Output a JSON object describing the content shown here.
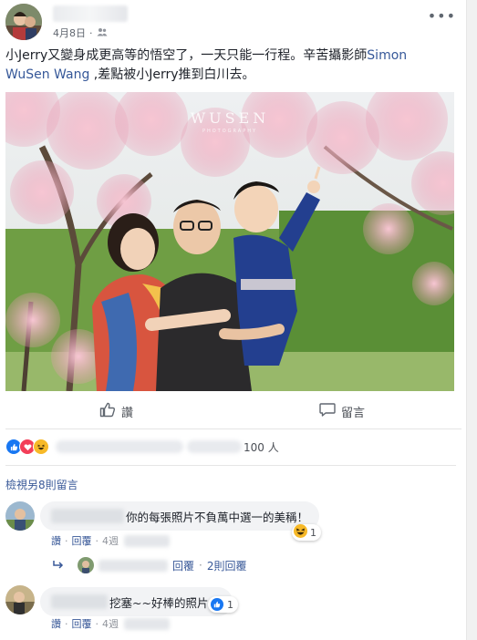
{
  "post": {
    "date": "4月8日",
    "privacy_icon": "friends-icon",
    "text_part1": "小Jerry又變身成更高等的悟空了，一天只能一行程。辛苦攝影師",
    "tagged_name": "Simon WuSen Wang",
    "text_part2": " ,差點被小Jerry推到白川去。",
    "watermark": "WUSEN",
    "watermark_sub": "PHOTOGRAPHY"
  },
  "actions": {
    "like_label": "讚",
    "comment_label": "留言"
  },
  "reactions": {
    "count_text": "還有其他 100 人",
    "count_visible": "100 人",
    "types": [
      "like",
      "love",
      "haha"
    ],
    "colors": {
      "like": "#1877f2",
      "love": "#f33e58",
      "haha": "#f7b928"
    }
  },
  "comments": {
    "view_more": "檢視另8則留言",
    "items": [
      {
        "text": "你的每張照片不負萬中選一的美稱！",
        "like_action": "讚",
        "reply_action": "回覆",
        "time": "4週",
        "reaction_count": "1",
        "reaction_type": "haha",
        "reply_summary_action": "回覆",
        "reply_summary_count": "2則回覆"
      },
      {
        "text": "挖塞~~好棒的照片!!!",
        "like_action": "讚",
        "reply_action": "回覆",
        "time": "4週",
        "reaction_count": "1",
        "reaction_type": "like"
      }
    ]
  }
}
